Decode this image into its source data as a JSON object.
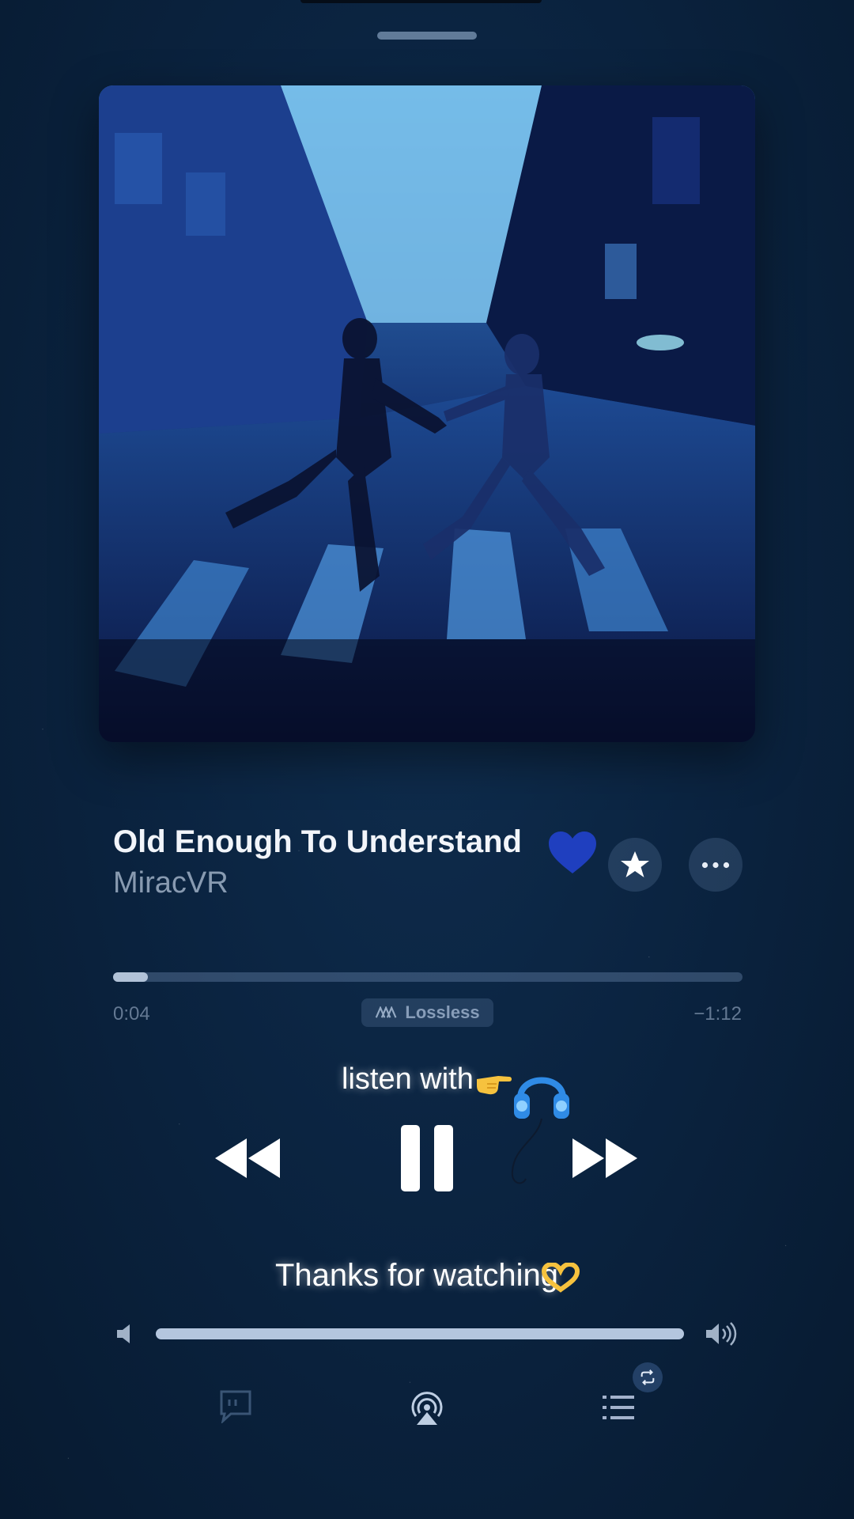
{
  "now_playing": {
    "title": "Old Enough To Understand",
    "artist": "MiracVR",
    "favorited": true,
    "heart_color": "#1f3fbf"
  },
  "progress": {
    "elapsed": "0:04",
    "remaining": "−1:12",
    "fraction": 0.055
  },
  "badge": {
    "label": "Lossless"
  },
  "overlay": {
    "listen_caption": "listen with",
    "thanks_caption": "Thanks for watching"
  },
  "volume": {
    "level": 1.0
  },
  "icons": {
    "star": "star-icon",
    "more": "ellipsis-icon",
    "rewind": "backward-icon",
    "pause": "pause-icon",
    "forward": "forward-icon",
    "lyrics": "lyrics-icon",
    "airplay": "airplay-icon",
    "queue": "queue-icon",
    "repeat": "repeat-icon"
  }
}
